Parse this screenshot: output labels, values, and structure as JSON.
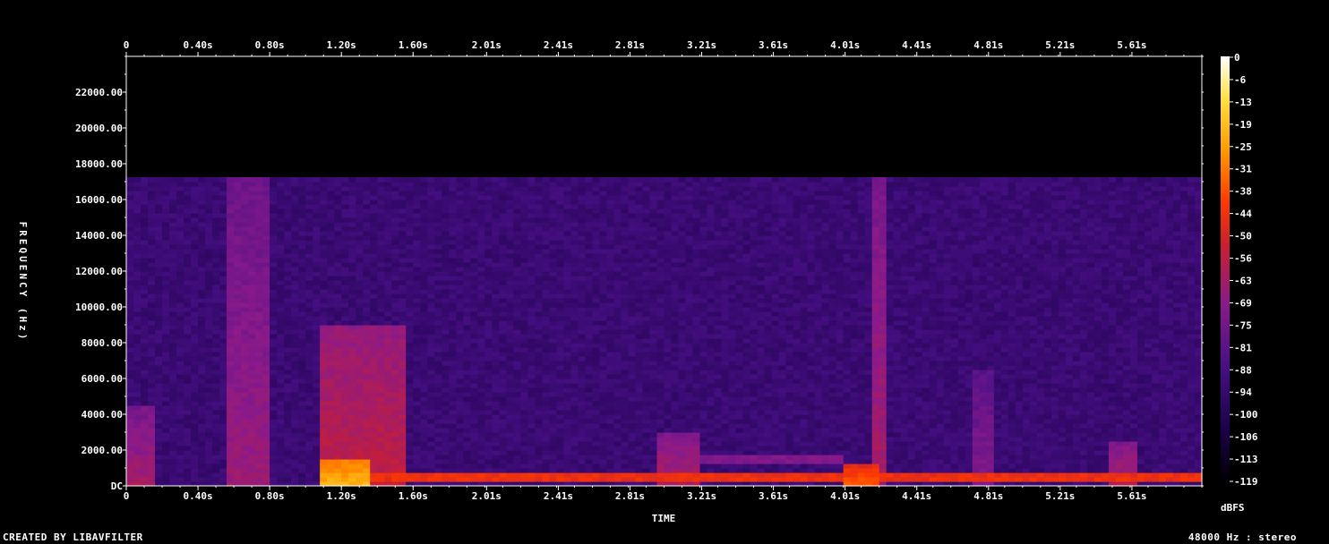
{
  "footer": {
    "created_by": "CREATED BY LIBAVFILTER",
    "format": "48000 Hz : stereo"
  },
  "chart_data": {
    "type": "heatmap",
    "title": "",
    "xlabel": "TIME",
    "ylabel": "FREQUENCY (Hz)",
    "colorbar_label": "dBFS",
    "xlim": [
      0,
      6.0
    ],
    "ylim": [
      0,
      24000
    ],
    "x_ticks": [
      0,
      0.4,
      0.8,
      1.2,
      1.6,
      2.01,
      2.41,
      2.81,
      3.21,
      3.61,
      4.01,
      4.41,
      4.81,
      5.21,
      5.61
    ],
    "x_tick_labels": [
      "0",
      "0.40s",
      "0.80s",
      "1.20s",
      "1.60s",
      "2.01s",
      "2.41s",
      "2.81s",
      "3.21s",
      "3.61s",
      "4.01s",
      "4.41s",
      "4.81s",
      "5.21s",
      "5.61s"
    ],
    "y_ticks": [
      0,
      2000,
      4000,
      6000,
      8000,
      10000,
      12000,
      14000,
      16000,
      18000,
      20000,
      22000
    ],
    "y_tick_labels": [
      "DC",
      "2000.00",
      "4000.00",
      "6000.00",
      "8000.00",
      "10000.00",
      "12000.00",
      "14000.00",
      "16000.00",
      "18000.00",
      "20000.00",
      "22000.00"
    ],
    "colorbar_ticks": [
      "0",
      "-6",
      "-13",
      "-19",
      "-25",
      "-31",
      "-38",
      "-44",
      "-50",
      "-56",
      "-63",
      "-69",
      "-75",
      "-81",
      "-88",
      "-94",
      "-100",
      "-106",
      "-113",
      "-119"
    ],
    "color_range_dbfs": [
      -119,
      0
    ],
    "colors": [
      "#000000",
      "#1a0048",
      "#4a1087",
      "#8a1a8a",
      "#cc1f2e",
      "#ff3a00",
      "#ff9a00",
      "#ffe040",
      "#ffffff"
    ],
    "spectrum_cutoff_hz": 17200,
    "background_level_dbfs": -92,
    "events": [
      {
        "start": 0.0,
        "end": 0.16,
        "max_hz": 4500,
        "level_dbfs": -62
      },
      {
        "start": 0.55,
        "end": 0.78,
        "max_hz": 17200,
        "level_dbfs": -65
      },
      {
        "start": 1.1,
        "end": 1.55,
        "max_hz": 9000,
        "level_dbfs": -55
      },
      {
        "start": 1.1,
        "end": 1.35,
        "max_hz": 1500,
        "level_dbfs": -20
      },
      {
        "start": 2.95,
        "end": 3.2,
        "max_hz": 3000,
        "level_dbfs": -60
      },
      {
        "start": 4.0,
        "end": 4.2,
        "max_hz": 1200,
        "level_dbfs": -35
      },
      {
        "start": 4.15,
        "end": 4.25,
        "max_hz": 17200,
        "level_dbfs": -62
      },
      {
        "start": 4.72,
        "end": 4.85,
        "max_hz": 6500,
        "level_dbfs": -70
      },
      {
        "start": 5.5,
        "end": 5.65,
        "max_hz": 2500,
        "level_dbfs": -60
      }
    ],
    "bands": [
      {
        "start": 1.1,
        "end": 6.0,
        "hz": 400,
        "level_dbfs": -45
      },
      {
        "start": 3.2,
        "end": 4.0,
        "hz": 1500,
        "level_dbfs": -72
      }
    ]
  }
}
